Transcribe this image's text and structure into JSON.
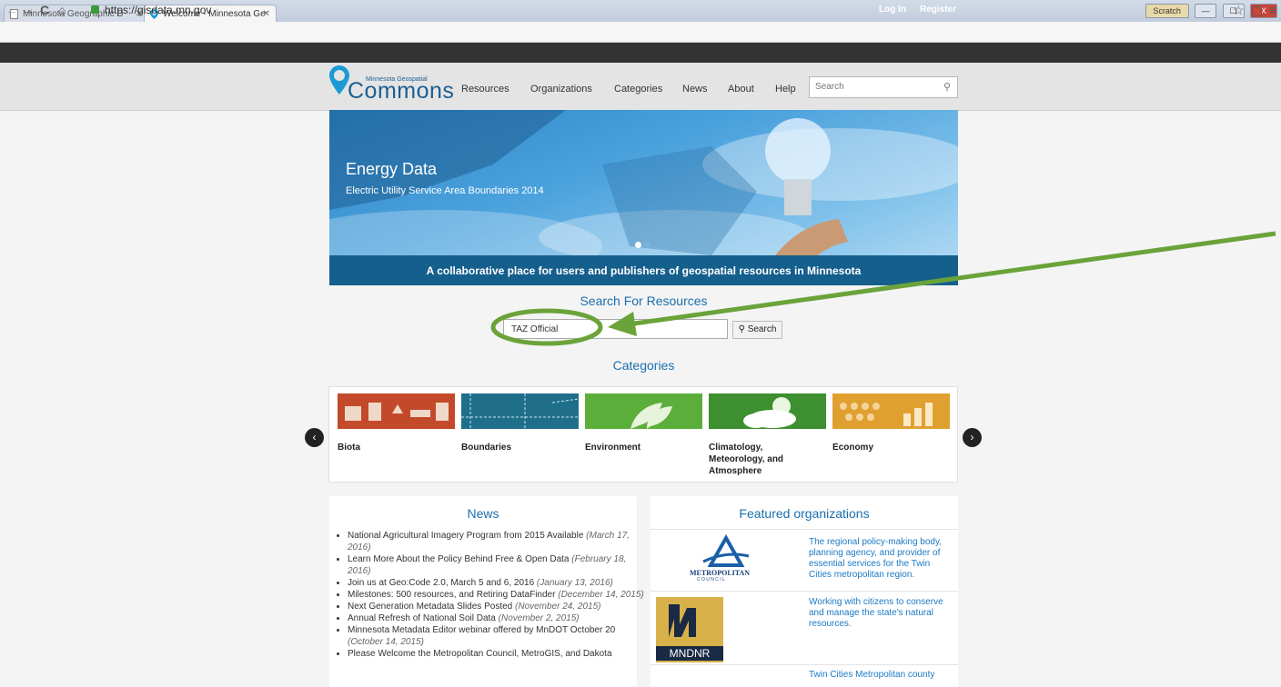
{
  "browser": {
    "tabs": [
      {
        "title": "Minnesota Geographic D"
      },
      {
        "title": "Welcome - Minnesota Ge"
      }
    ],
    "url": "https://gisdata.mn.gov",
    "window_buttons": [
      "Scratch",
      "—",
      "☐",
      "X"
    ]
  },
  "topbar": {
    "login": "Log In",
    "register": "Register"
  },
  "header": {
    "logo_small": "Minnesota Geospatial",
    "logo_big": "Commons",
    "nav": [
      "Resources",
      "Organizations",
      "Categories",
      "News",
      "About",
      "Help"
    ],
    "search_placeholder": "Search"
  },
  "hero": {
    "title": "Energy Data",
    "subtitle": "Electric Utility Service Area Boundaries 2014",
    "tagline": "A collaborative place for users and publishers of geospatial resources in Minnesota"
  },
  "search_section": {
    "title": "Search For Resources",
    "query": "TAZ Official",
    "button": "Search"
  },
  "categories": {
    "title": "Categories",
    "items": [
      {
        "label": "Biota",
        "color": "#c24a2a"
      },
      {
        "label": "Boundaries",
        "color": "#1f6f8b"
      },
      {
        "label": "Environment",
        "color": "#5cae3a"
      },
      {
        "label": "Climatology, Meteorology, and Atmosphere",
        "color": "#3d8f2f"
      },
      {
        "label": "Economy",
        "color": "#e0a030"
      }
    ]
  },
  "news": {
    "title": "News",
    "items": [
      {
        "text": "National Agricultural Imagery Program from 2015 Available",
        "date": "(March 17, 2016)"
      },
      {
        "text": "Learn More About the Policy Behind Free & Open Data",
        "date": "(February 18, 2016)"
      },
      {
        "text": "Join us at Geo:Code 2.0, March 5 and 6, 2016",
        "date": "(January 13, 2016)"
      },
      {
        "text": "Milestones: 500 resources, and Retiring DataFinder",
        "date": "(December 14, 2015)"
      },
      {
        "text": "Next Generation Metadata Slides Posted",
        "date": "(November 24, 2015)"
      },
      {
        "text": "Annual Refresh of National Soil Data",
        "date": "(November 2, 2015)"
      },
      {
        "text": "Minnesota Metadata Editor webinar offered by MnDOT October 20",
        "date": "(October 14, 2015)"
      },
      {
        "text": "Please Welcome the Metropolitan Council, MetroGIS, and Dakota",
        "date": ""
      }
    ]
  },
  "featured": {
    "title": "Featured organizations",
    "orgs": [
      {
        "logo_text": "METROPOLITAN",
        "logo_sub": "C O U N C I L",
        "desc": "The regional policy-making body, planning agency, and provider of essential services for the Twin Cities metropolitan region."
      },
      {
        "logo_text": "MNDNR",
        "desc": "Working with citizens to conserve and manage the state's natural resources."
      },
      {
        "desc": "Twin Cities Metropolitan county"
      }
    ]
  },
  "colors": {
    "accent": "#1b6fae",
    "annotation": "#6aa33a",
    "topbar": "#333333",
    "hero_band": "#155f8d"
  }
}
